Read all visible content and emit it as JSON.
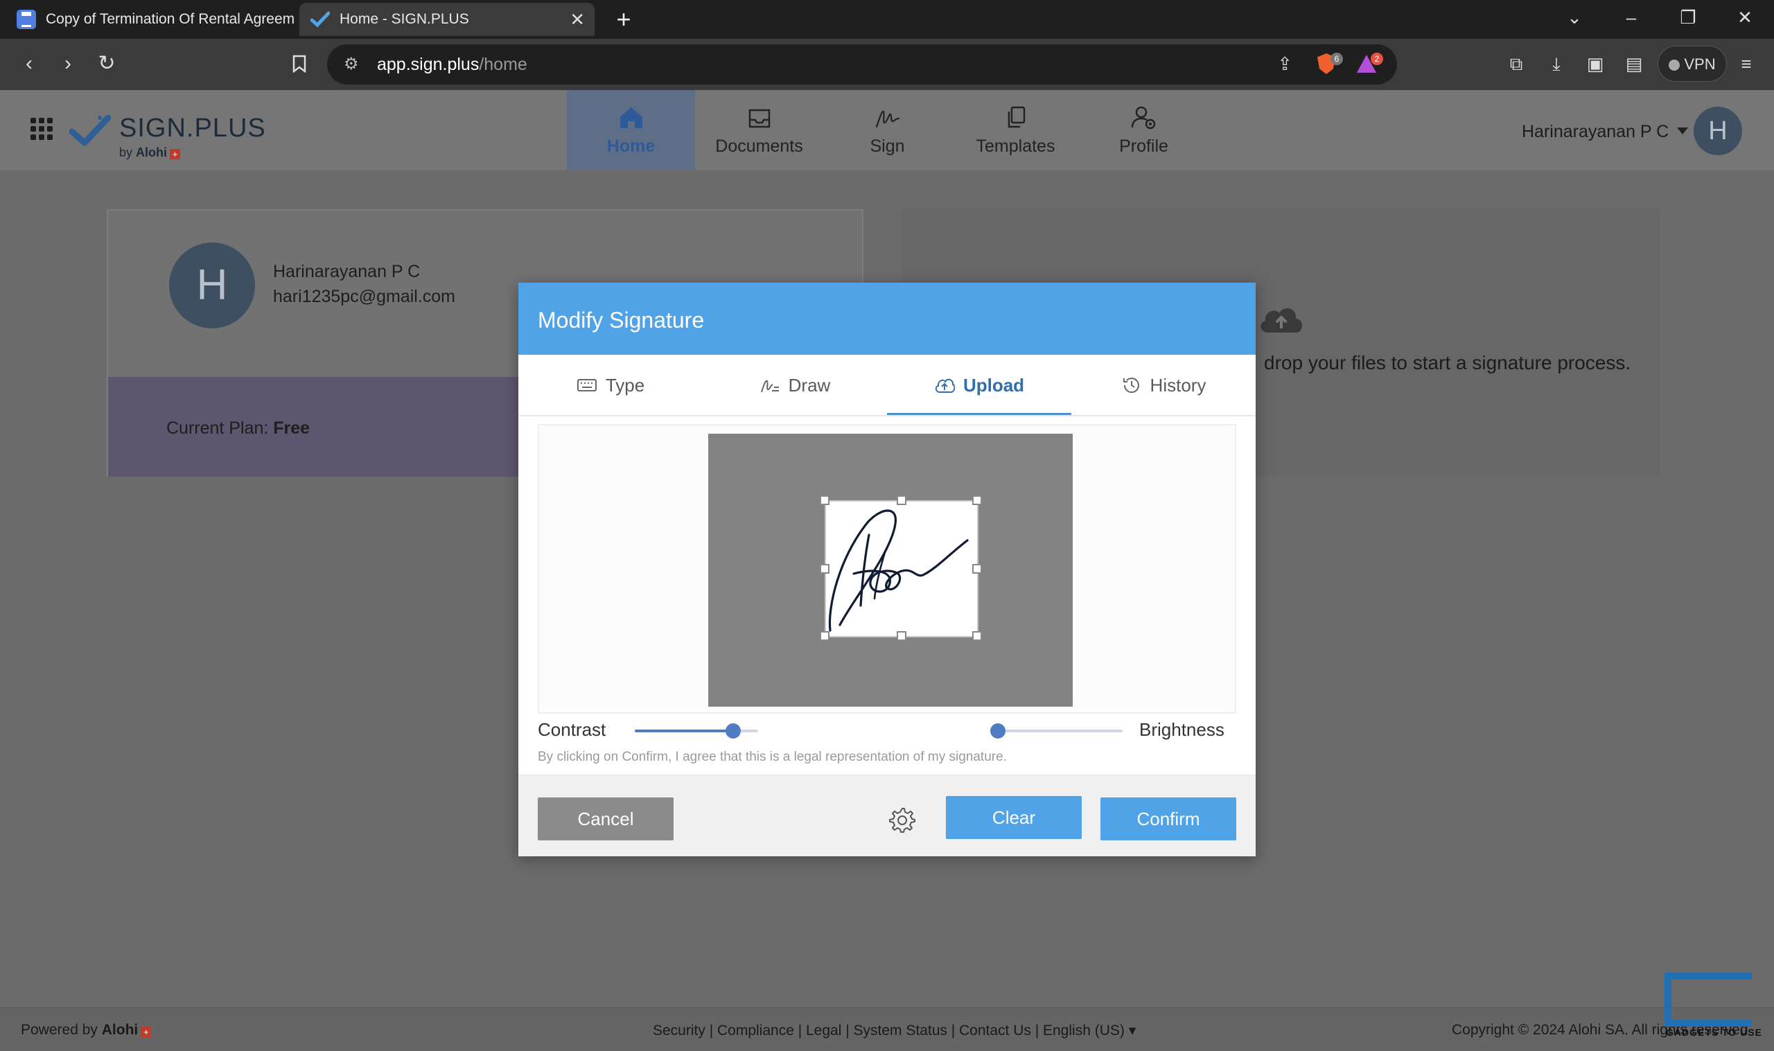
{
  "browser": {
    "tabs": [
      {
        "title": "Copy of Termination Of Rental Agreem",
        "active": false
      },
      {
        "title": "Home - SIGN.PLUS",
        "active": true
      }
    ],
    "new_tab": "+",
    "url_host": "app.sign.plus",
    "url_path": "/home",
    "brave_badge": "6",
    "rewards_badge": "2",
    "vpn_label": "VPN"
  },
  "app": {
    "logo_name": "SIGN.PLUS",
    "logo_by": "by",
    "logo_brand": "Alohi",
    "nav": [
      {
        "label": "Home",
        "icon": "home-icon",
        "active": true
      },
      {
        "label": "Documents",
        "icon": "inbox-icon",
        "active": false
      },
      {
        "label": "Sign",
        "icon": "signature-icon",
        "active": false
      },
      {
        "label": "Templates",
        "icon": "copy-icon",
        "active": false
      },
      {
        "label": "Profile",
        "icon": "user-gear-icon",
        "active": false
      }
    ],
    "user_name": "Harinarayanan P C",
    "avatar_initial": "H"
  },
  "dashboard": {
    "profile_initial": "H",
    "profile_name": "Harinarayanan P C",
    "profile_email": "hari1235pc@gmail.com",
    "plan_label": "Current Plan:",
    "plan_value": "Free",
    "drop_text": "drop your files to start a signature process."
  },
  "modal": {
    "title": "Modify Signature",
    "tabs": [
      {
        "label": "Type",
        "icon": "keyboard-icon",
        "active": false
      },
      {
        "label": "Draw",
        "icon": "draw-icon",
        "active": false
      },
      {
        "label": "Upload",
        "icon": "cloud-upload-icon",
        "active": true
      },
      {
        "label": "History",
        "icon": "history-icon",
        "active": false
      }
    ],
    "contrast_label": "Contrast",
    "brightness_label": "Brightness",
    "contrast_value": 0.8,
    "brightness_value": 0.0,
    "legal_text": "By clicking on Confirm, I agree that this is a legal representation of my signature.",
    "cancel_label": "Cancel",
    "clear_label": "Clear",
    "confirm_label": "Confirm"
  },
  "footer": {
    "powered_by": "Powered by",
    "brand": "Alohi",
    "links": "Security | Compliance | Legal | System Status | Contact Us | English (US)",
    "copyright": "Copyright © 2024 Alohi SA. All rights reserved",
    "watermark": "GADGETS TO USE"
  },
  "colors": {
    "modal_header": "#4fa3e6",
    "primary_button": "#4fa3e6",
    "accent": "#4f7cc2"
  }
}
